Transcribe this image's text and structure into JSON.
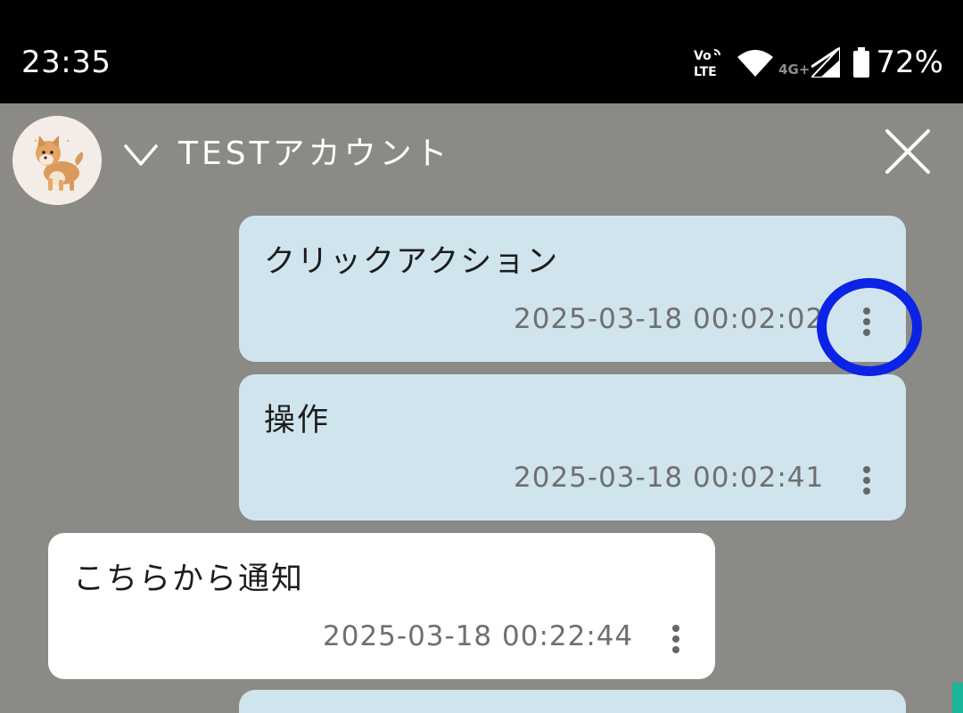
{
  "status_bar": {
    "time": "23:35",
    "network_label": "4G+",
    "battery_percent": "72%",
    "icons": [
      "volte-icon",
      "wifi-icon",
      "signal-icon",
      "battery-icon"
    ]
  },
  "header": {
    "title": "TESTアカウント",
    "avatar": "shiba-dog-avatar",
    "icons": [
      "chevron-down-icon",
      "close-icon"
    ]
  },
  "messages": [
    {
      "text": "クリックアクション",
      "timestamp": "2025-03-18 00:02:02",
      "sender": "self"
    },
    {
      "text": "操作",
      "timestamp": "2025-03-18 00:02:41",
      "sender": "self"
    },
    {
      "text": "こちらから通知",
      "timestamp": "2025-03-18 00:22:44",
      "sender": "other"
    }
  ],
  "colors": {
    "background": "#8b8a86",
    "sent_bubble": "#d0e4ee",
    "received_bubble": "#ffffff",
    "highlight_ring": "#0a23e6",
    "status_bar": "#000000"
  }
}
